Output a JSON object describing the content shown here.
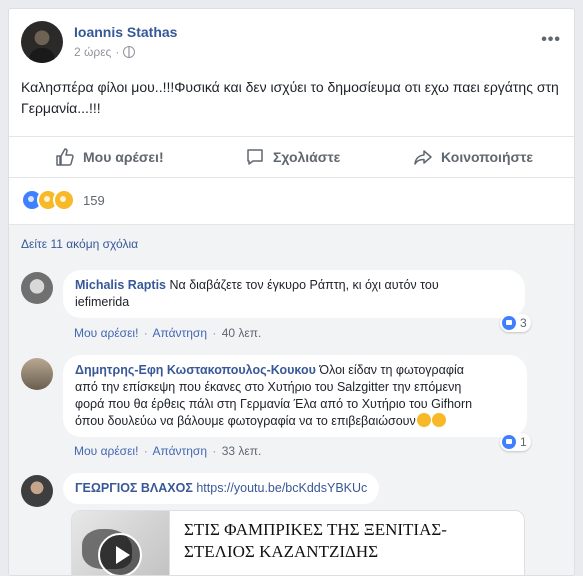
{
  "post": {
    "author": "Ioannis Stathas",
    "time": "2 ώρες",
    "meta_dot": "·",
    "more": "•••",
    "text": "Καλησπέρα φίλοι μου..!!!Φυσικά και δεν ισχύει το δημοσίευμα οτι εχω παει εργάτης στη Γερμανία...!!!"
  },
  "actions": {
    "like": "Μου αρέσει!",
    "comment": "Σχολιάστε",
    "share": "Κοινοποιήστε"
  },
  "reactions": {
    "icons": [
      "like-reaction",
      "haha-reaction",
      "wow-reaction"
    ],
    "count": "159"
  },
  "comments_section": {
    "view_more": "Δείτε 11 ακόμη σχόλια",
    "action_like": "Μου αρέσει!",
    "action_reply": "Απάντηση",
    "separator": "·",
    "items": [
      {
        "name": "Michalis Raptis",
        "text_line1": " Να διαβάζετε τον έγκυρο Ράπτη, κι όχι αυτόν του",
        "text_line2": "iefimerida",
        "time": "40 λεπ.",
        "likes": "3"
      },
      {
        "name": "Δημητρης-Εφη Κωστακοπουλος-Κουκου",
        "text_line1": " Όλοι είδαν τη φωτογραφία",
        "text_line2": "από την επίσκεψη που έκανες στο Χυτήριο του Salzgitter την επόμενη",
        "text_line3": "φορά που θα έρθεις πάλι στη Γερμανία Έλα από το Χυτήριο του Gifhorn",
        "text_line4": "όπου δουλεύω να βάλουμε φωτογραφία να το επιβεβαιώσουν",
        "time": "33 λεπ.",
        "likes": "1"
      },
      {
        "name": "ΓΕΩΡΓΙΟΣ ΒΛΑΧΟΣ",
        "link": "https://youtu.be/bcKddsYBKUc",
        "preview_title": "ΣΤΙΣ ΦΑΜΠΡΙΚΕΣ ΤΗΣ ΞΕΝΙΤΙΑΣ-ΣΤΕΛΙΟΣ ΚΑΖΑΝΤΖΙΔΗΣ"
      }
    ]
  },
  "colors": {
    "link": "#365899",
    "background": "#e9ebee",
    "comment_area": "#f2f3f5",
    "like_blue": "#4080ff"
  }
}
